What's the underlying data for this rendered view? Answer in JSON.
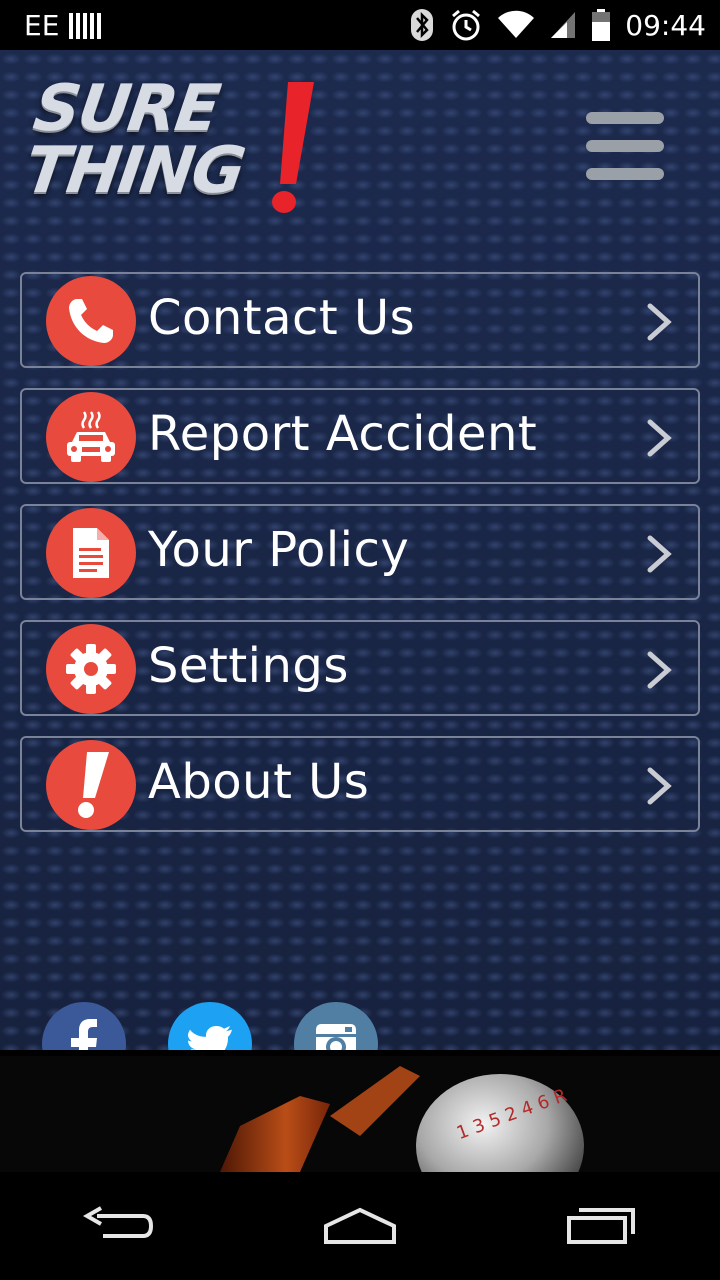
{
  "status_bar": {
    "carrier": "EE",
    "time": "09:44",
    "icons": [
      "signal-bars-icon",
      "bluetooth-icon",
      "alarm-icon",
      "wifi-icon",
      "cell-signal-icon",
      "battery-icon"
    ]
  },
  "header": {
    "logo_line1": "SURE",
    "logo_line2": "THING",
    "menu_icon": "hamburger-icon"
  },
  "menu": [
    {
      "label": "Contact Us",
      "icon": "phone-icon"
    },
    {
      "label": "Report Accident",
      "icon": "car-accident-icon"
    },
    {
      "label": "Your Policy",
      "icon": "document-icon"
    },
    {
      "label": "Settings",
      "icon": "gear-icon"
    },
    {
      "label": "About Us",
      "icon": "exclamation-icon"
    }
  ],
  "social": [
    {
      "name": "facebook",
      "color": "#3b5998"
    },
    {
      "name": "twitter",
      "color": "#1da1f2"
    },
    {
      "name": "instagram",
      "color": "#517fa4"
    }
  ],
  "colors": {
    "accent": "#e84a3d",
    "background": "#1b2747",
    "border": "#7a8297"
  },
  "banner": {
    "gear_numbers": "1 3 5 2 4 6 R"
  },
  "nav_bar": [
    "back-icon",
    "home-icon",
    "recents-icon"
  ]
}
